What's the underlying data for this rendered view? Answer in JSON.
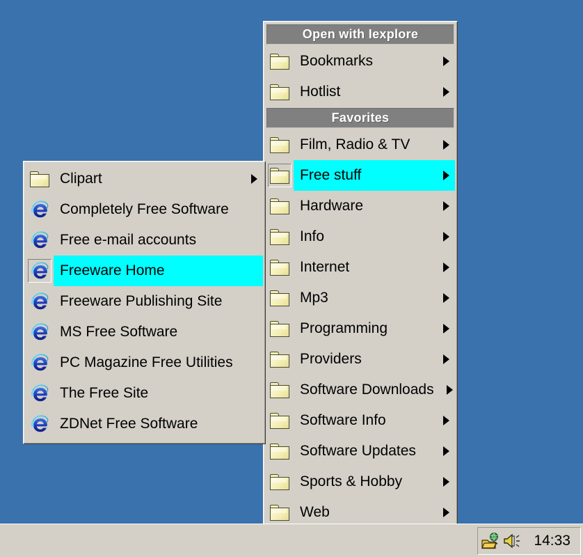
{
  "desktop": {
    "background_color": "#3a72ad"
  },
  "theme": {
    "menu_face": "#d4d0c8",
    "header_bg": "#808080",
    "header_text": "#ffffff",
    "highlight": "#00ffff",
    "text": "#000000",
    "folder_yellow": "#f7f2bd",
    "ie_blue": "#1a3fb5",
    "ie_cyan": "#39c6e8"
  },
  "favorites_menu": {
    "name": "favorites-menu",
    "headers": {
      "open_with": "Open with Iexplore",
      "favorites": "Favorites"
    },
    "open_with_items": [
      {
        "label": "Bookmarks",
        "icon": "folder-icon",
        "has_submenu": true,
        "selected": false
      },
      {
        "label": "Hotlist",
        "icon": "folder-icon",
        "has_submenu": true,
        "selected": false
      }
    ],
    "favorites_items": [
      {
        "label": "Film, Radio & TV",
        "icon": "folder-icon",
        "has_submenu": true,
        "selected": false
      },
      {
        "label": "Free stuff",
        "icon": "folder-icon",
        "has_submenu": true,
        "selected": true
      },
      {
        "label": "Hardware",
        "icon": "folder-icon",
        "has_submenu": true,
        "selected": false
      },
      {
        "label": "Info",
        "icon": "folder-icon",
        "has_submenu": true,
        "selected": false
      },
      {
        "label": "Internet",
        "icon": "folder-icon",
        "has_submenu": true,
        "selected": false
      },
      {
        "label": "Mp3",
        "icon": "folder-icon",
        "has_submenu": true,
        "selected": false
      },
      {
        "label": "Programming",
        "icon": "folder-icon",
        "has_submenu": true,
        "selected": false
      },
      {
        "label": "Providers",
        "icon": "folder-icon",
        "has_submenu": true,
        "selected": false
      },
      {
        "label": "Software Downloads",
        "icon": "folder-icon",
        "has_submenu": true,
        "selected": false,
        "wide": true
      },
      {
        "label": "Software Info",
        "icon": "folder-icon",
        "has_submenu": true,
        "selected": false
      },
      {
        "label": "Software Updates",
        "icon": "folder-icon",
        "has_submenu": true,
        "selected": false
      },
      {
        "label": "Sports & Hobby",
        "icon": "folder-icon",
        "has_submenu": true,
        "selected": false
      },
      {
        "label": "Web",
        "icon": "folder-icon",
        "has_submenu": true,
        "selected": false
      }
    ]
  },
  "freestuff_submenu": {
    "name": "free-stuff-submenu",
    "items": [
      {
        "label": "Clipart",
        "icon": "folder-icon",
        "has_submenu": true,
        "selected": false
      },
      {
        "label": "Completely Free Software",
        "icon": "internet-explorer-icon",
        "has_submenu": false,
        "selected": false
      },
      {
        "label": "Free e-mail accounts",
        "icon": "internet-explorer-icon",
        "has_submenu": false,
        "selected": false
      },
      {
        "label": "Freeware Home",
        "icon": "internet-explorer-icon",
        "has_submenu": false,
        "selected": true
      },
      {
        "label": "Freeware Publishing Site",
        "icon": "internet-explorer-icon",
        "has_submenu": false,
        "selected": false
      },
      {
        "label": "MS Free Software",
        "icon": "internet-explorer-icon",
        "has_submenu": false,
        "selected": false
      },
      {
        "label": "PC Magazine Free Utilities",
        "icon": "internet-explorer-icon",
        "has_submenu": false,
        "selected": false
      },
      {
        "label": "The Free Site",
        "icon": "internet-explorer-icon",
        "has_submenu": false,
        "selected": false
      },
      {
        "label": "ZDNet Free Software",
        "icon": "internet-explorer-icon",
        "has_submenu": false,
        "selected": false
      }
    ]
  },
  "taskbar": {
    "tray": {
      "icons": [
        {
          "name": "shared-folder-network-icon"
        },
        {
          "name": "volume-speaker-icon"
        }
      ],
      "clock": "14:33"
    }
  }
}
